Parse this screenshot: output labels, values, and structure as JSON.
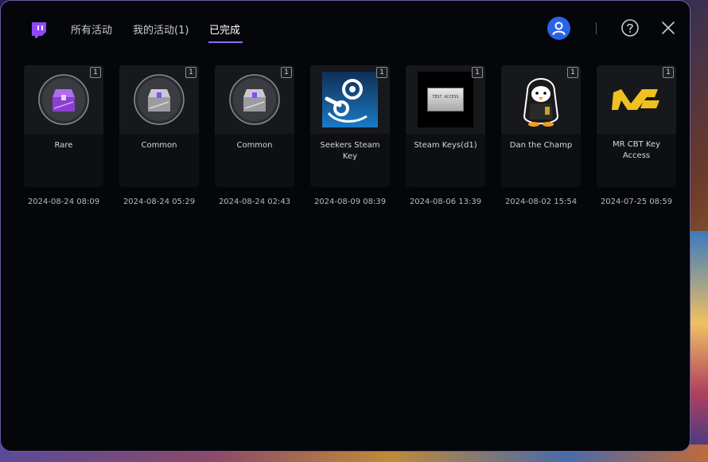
{
  "header": {
    "tabs": [
      {
        "label": "所有活动",
        "active": false
      },
      {
        "label": "我的活动(1)",
        "active": false
      },
      {
        "label": "已完成",
        "active": true
      }
    ]
  },
  "colors": {
    "accent": "#8f6df5",
    "twitch_purple": "#9146ff",
    "avatar_blue": "#2b63e8",
    "steam_blue": "#1a6fb5"
  },
  "rewards": [
    {
      "icon": "rare-chest-icon",
      "label": "Rare",
      "count": "1",
      "date": "2024-08-24 08:09"
    },
    {
      "icon": "common-chest-icon",
      "label": "Common",
      "count": "1",
      "date": "2024-08-24 05:29"
    },
    {
      "icon": "common-chest-icon",
      "label": "Common",
      "count": "1",
      "date": "2024-08-24 02:43"
    },
    {
      "icon": "steam-logo-icon",
      "label": "Seekers Steam Key",
      "count": "1",
      "date": "2024-08-09 08:39"
    },
    {
      "icon": "test-access-card-icon",
      "label": "Steam Keys(d1)",
      "count": "1",
      "date": "2024-08-06 13:39",
      "image_text": "TEST ACCESS"
    },
    {
      "icon": "penguin-icon",
      "label": "Dan the Champ",
      "count": "1",
      "date": "2024-08-02 15:54"
    },
    {
      "icon": "mr-logo-icon",
      "label": "MR CBT Key Access",
      "count": "1",
      "date": "2024-07-25 08:59"
    }
  ]
}
